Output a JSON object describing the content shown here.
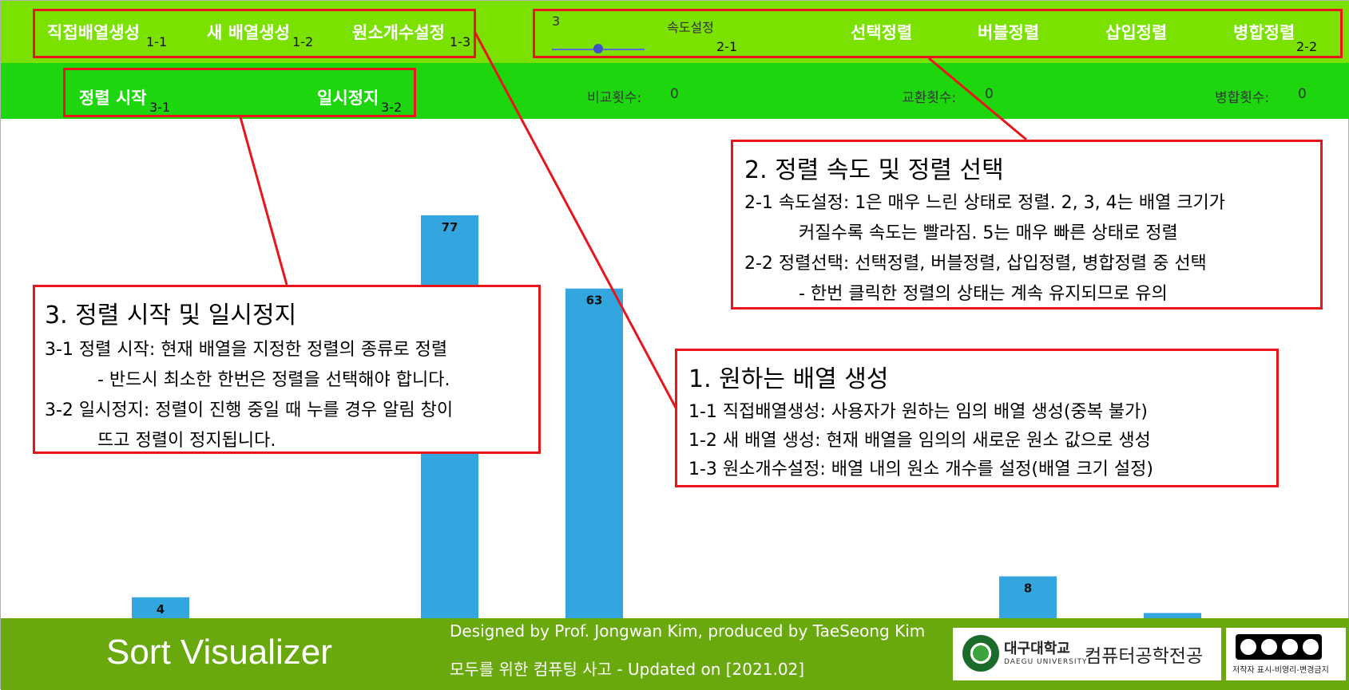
{
  "topbar": {
    "buttons": [
      {
        "label": "직접배열생성",
        "tag": "1-1"
      },
      {
        "label": "새 배열생성",
        "tag": "1-2"
      },
      {
        "label": "원소개수설정",
        "tag": "1-3"
      }
    ],
    "speed": {
      "label": "속도설정",
      "value": "3",
      "level_fraction": 0.5,
      "tag": "2-1"
    },
    "sorts": [
      {
        "label": "선택정렬"
      },
      {
        "label": "버블정렬"
      },
      {
        "label": "삽입정렬"
      },
      {
        "label": "병합정렬",
        "tag": "2-2"
      }
    ]
  },
  "subbar": {
    "start": {
      "label": "정렬 시작",
      "tag": "3-1"
    },
    "pause": {
      "label": "일시정지",
      "tag": "3-2"
    },
    "counters": [
      {
        "label": "비교횟수:",
        "value": "0"
      },
      {
        "label": "교환횟수:",
        "value": "0"
      },
      {
        "label": "병합횟수:",
        "value": "0"
      }
    ]
  },
  "callouts": {
    "c1": {
      "title": "1. 원하는 배열 생성",
      "lines": [
        "1-1 직접배열생성: 사용자가 원하는 임의 배열 생성(중복 불가)",
        "1-2 새 배열 생성: 현재 배열을 임의의 새로운 원소 값으로 생성",
        "1-3 원소개수설정: 배열 내의 원소 개수를 설정(배열 크기 설정)"
      ]
    },
    "c2": {
      "title": "2. 정렬 속도 및 정렬 선택",
      "lines": [
        "2-1 속도설정: 1은 매우 느린 상태로 정렬. 2, 3, 4는 배열 크기가",
        "커질수록 속도는 빨라짐. 5는 매우 빠른 상태로 정렬",
        "2-2 정렬선택: 선택정렬, 버블정렬, 삽입정렬, 병합정렬 중 선택",
        "- 한번 클릭한 정렬의 상태는 계속 유지되므로 유의"
      ]
    },
    "c3": {
      "title": "3. 정렬 시작 및 일시정지",
      "lines": [
        "3-1 정렬 시작: 현재 배열을 지정한 정렬의 종류로 정렬",
        "- 반드시 최소한 한번은 정렬을 선택해야 합니다.",
        "3-2 일시정지: 정렬이 진행 중일 때 누를 경우 알림 창이",
        "뜨고 정렬이 정지됩니다."
      ]
    }
  },
  "chart_data": {
    "type": "bar",
    "values": [
      4,
      null,
      77,
      63,
      null,
      null,
      8,
      1
    ],
    "ylim": [
      0,
      100
    ],
    "color": "#34a6df"
  },
  "footer": {
    "brand": "Sort Visualizer",
    "credit1": "Designed by Prof. Jongwan Kim, produced by TaeSeong Kim",
    "credit2": "모두를 위한 컴퓨팅 사고 - Updated on [2021.02]",
    "univ_name": "대구대학교",
    "univ_en": "DAEGU UNIVERSITY",
    "dept": "컴퓨터공학전공",
    "license": "저작자 표시-비영리-변경금지"
  },
  "colors": {
    "topbar": "#7ae100",
    "subbar": "#1ed60d",
    "footer": "#6aa90e",
    "annotation": "#e8151b",
    "bar": "#34a6df"
  }
}
